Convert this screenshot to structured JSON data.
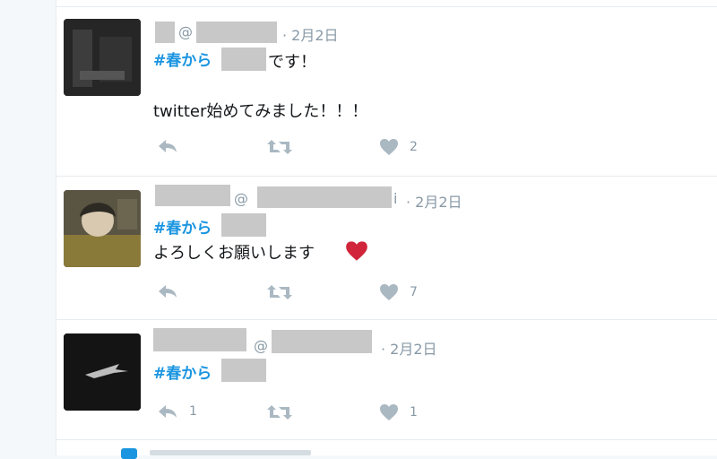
{
  "tweets": [
    {
      "handle_prefix": "@",
      "date": "· 2月2日",
      "hashtag": "#春から",
      "line1_suffix": "です！",
      "line2": "twitter始めてみました！！！",
      "reply_count": "",
      "retweet_count": "",
      "like_count": "2"
    },
    {
      "handle_prefix": "@",
      "handle_tail": "i",
      "date": "· 2月2日",
      "hashtag": "#春から",
      "line2": "よろしくお願いします",
      "reply_count": "",
      "retweet_count": "",
      "like_count": "7"
    },
    {
      "handle_prefix": "@",
      "date": "· 2月2日",
      "hashtag": "#春から",
      "reply_count": "1",
      "retweet_count": "",
      "like_count": "1"
    }
  ],
  "icons": [
    "reply-icon",
    "retweet-icon",
    "heart-icon",
    "red-heart-emoji-icon"
  ],
  "colors": {
    "hashtag": "#1b95e0",
    "meta": "#8899a6",
    "icon": "#aab8c2",
    "redaction": "#c8c8c8",
    "red_heart": "#d0253a",
    "page_background": "#f5f8fa"
  }
}
